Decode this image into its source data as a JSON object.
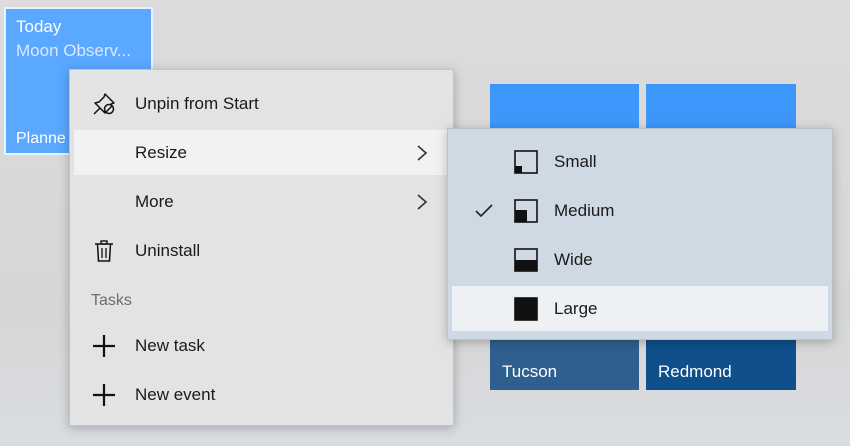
{
  "tiles": {
    "planner": {
      "line1": "Today",
      "line2": "Moon Observ...",
      "line3": "Planne"
    },
    "tucson": {
      "label": "Tucson"
    },
    "redmond": {
      "label": "Redmond"
    }
  },
  "context_menu": {
    "items": [
      {
        "label": "Unpin from Start",
        "icon": "unpin-icon"
      },
      {
        "label": "Resize",
        "icon": "",
        "has_submenu": true
      },
      {
        "label": "More",
        "icon": "",
        "has_submenu": true
      },
      {
        "label": "Uninstall",
        "icon": "trash-icon"
      }
    ],
    "tasks_header": "Tasks",
    "tasks": [
      {
        "label": "New task",
        "icon": "plus-icon"
      },
      {
        "label": "New event",
        "icon": "plus-icon"
      }
    ]
  },
  "resize_submenu": {
    "items": [
      {
        "label": "Small",
        "icon": "small-size-icon",
        "checked": false
      },
      {
        "label": "Medium",
        "icon": "medium-size-icon",
        "checked": true
      },
      {
        "label": "Wide",
        "icon": "wide-size-icon",
        "checked": false
      },
      {
        "label": "Large",
        "icon": "large-size-icon",
        "checked": false
      }
    ]
  },
  "colors": {
    "tile_accent": "#3d97fb",
    "planner_tile": "#5aa8ff",
    "tucson_tile": "#2f5f8f",
    "redmond_tile": "#0f4f8c"
  }
}
